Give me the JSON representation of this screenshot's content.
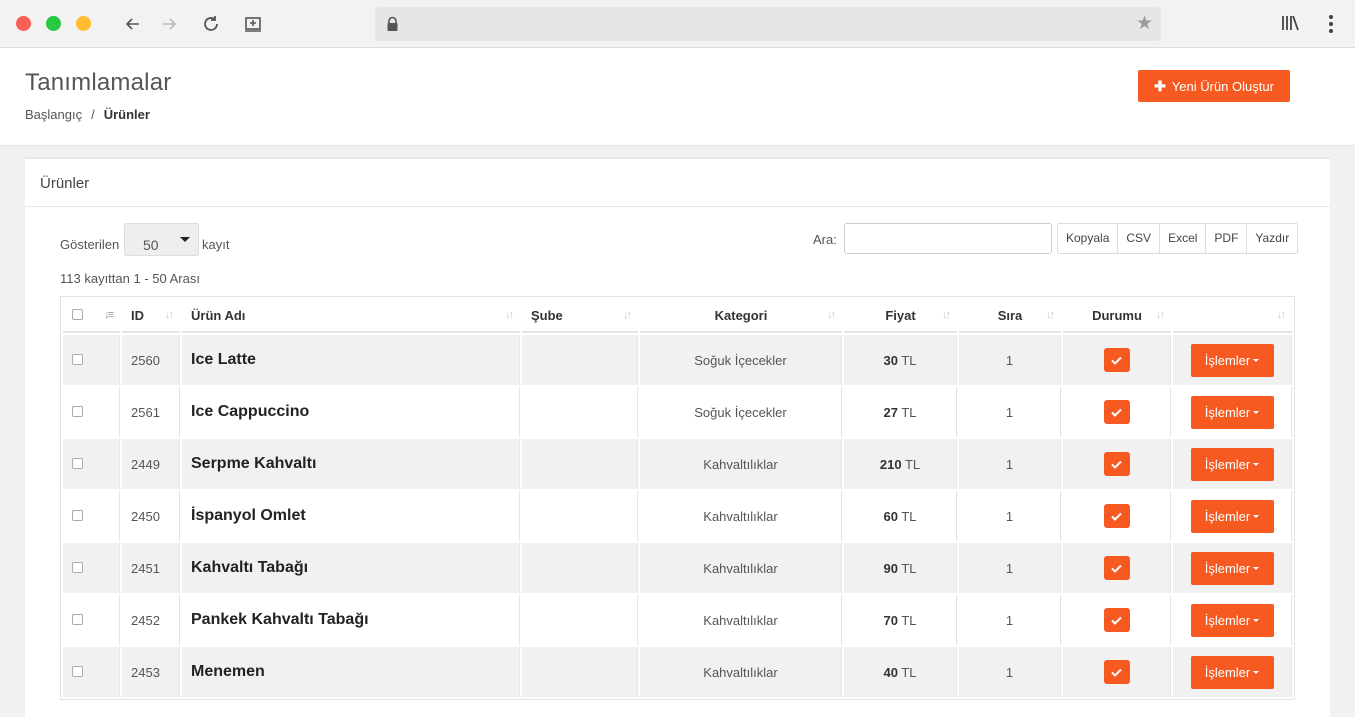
{
  "browser": {
    "back_icon": "arrow-left-icon",
    "forward_icon": "arrow-right-icon",
    "reload_icon": "reload-icon",
    "screenshot_icon": "screenshot-icon",
    "lock_icon": "lock-icon",
    "bookmark_icon": "star-icon",
    "library_icon": "library-icon",
    "menu_icon": "kebab-menu-icon"
  },
  "header": {
    "title": "Tanımlamalar",
    "breadcrumb": {
      "home": "Başlangıç",
      "separator": "/",
      "current": "Ürünler"
    },
    "new_button": "Yeni Ürün Oluştur"
  },
  "card": {
    "title": "Ürünler",
    "show_label": "Gösterilen",
    "page_length": "50",
    "entries_label": "kayıt",
    "info": "113 kayıttan 1 - 50 Arası",
    "search_label": "Ara:",
    "search_value": "",
    "export_buttons": [
      "Kopyala",
      "CSV",
      "Excel",
      "PDF",
      "Yazdır"
    ]
  },
  "table": {
    "headers": {
      "id": "ID",
      "name": "Ürün Adı",
      "branch": "Şube",
      "category": "Kategori",
      "price": "Fiyat",
      "order": "Sıra",
      "status": "Durumu",
      "actions": ""
    },
    "currency": "TL",
    "actions_label": "İşlemler",
    "rows": [
      {
        "id": "2560",
        "name": "Ice Latte",
        "branch": "",
        "category": "Soğuk İçecekler",
        "price": "30",
        "order": "1",
        "active": true
      },
      {
        "id": "2561",
        "name": "Ice Cappuccino",
        "branch": "",
        "category": "Soğuk İçecekler",
        "price": "27",
        "order": "1",
        "active": true
      },
      {
        "id": "2449",
        "name": "Serpme Kahvaltı",
        "branch": "",
        "category": "Kahvaltılıklar",
        "price": "210",
        "order": "1",
        "active": true
      },
      {
        "id": "2450",
        "name": "İspanyol Omlet",
        "branch": "",
        "category": "Kahvaltılıklar",
        "price": "60",
        "order": "1",
        "active": true
      },
      {
        "id": "2451",
        "name": "Kahvaltı Tabağı",
        "branch": "",
        "category": "Kahvaltılıklar",
        "price": "90",
        "order": "1",
        "active": true
      },
      {
        "id": "2452",
        "name": "Pankek Kahvaltı Tabağı",
        "branch": "",
        "category": "Kahvaltılıklar",
        "price": "70",
        "order": "1",
        "active": true
      },
      {
        "id": "2453",
        "name": "Menemen",
        "branch": "",
        "category": "Kahvaltılıklar",
        "price": "40",
        "order": "1",
        "active": true
      }
    ]
  },
  "colors": {
    "accent": "#f65a21",
    "stripe": "#f1f1f1"
  }
}
